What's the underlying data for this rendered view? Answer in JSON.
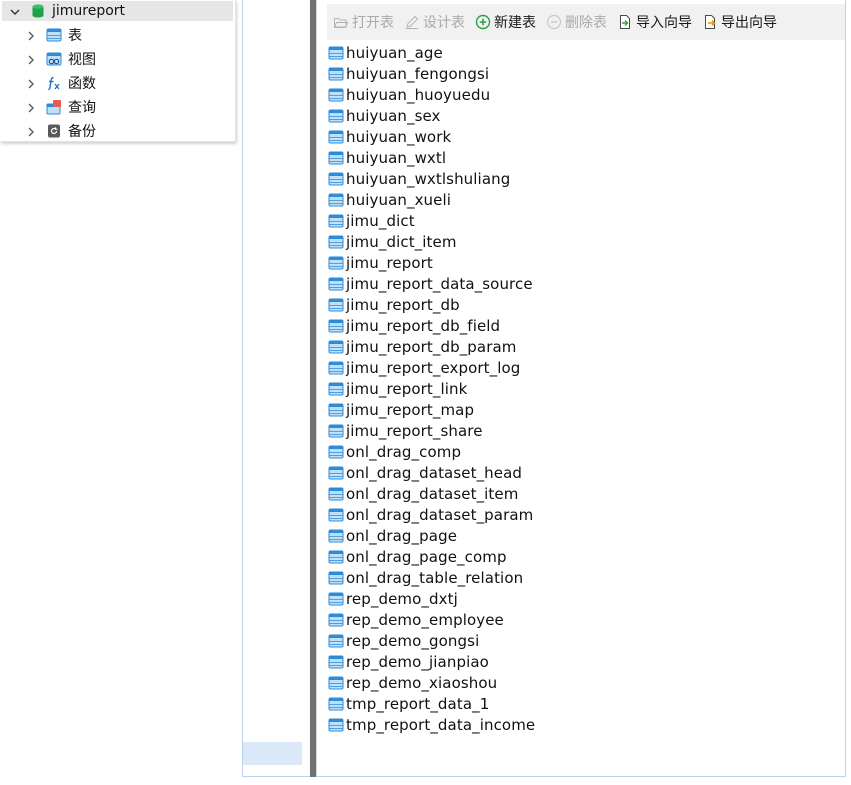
{
  "colors": {
    "accent_blue": "#1a73c6",
    "list_icon_blue": "#2f8ad8",
    "root_db_green": "#1fa34a",
    "new_table_green": "#2ea043",
    "disabled_gray": "#a9a9a9",
    "splitter_gray": "#707070",
    "frame_border": "#bcd3f0"
  },
  "nav_tree": {
    "root": {
      "label": "jimureport",
      "icon": "database-icon",
      "expanded": true
    },
    "children": [
      {
        "label": "表",
        "icon": "table-icon"
      },
      {
        "label": "视图",
        "icon": "view-icon"
      },
      {
        "label": "函数",
        "icon": "function-icon"
      },
      {
        "label": "查询",
        "icon": "query-icon"
      },
      {
        "label": "备份",
        "icon": "backup-icon"
      }
    ]
  },
  "toolbar": {
    "open_table": {
      "label": "打开表",
      "icon": "folder-open-icon",
      "enabled": false
    },
    "design_table": {
      "label": "设计表",
      "icon": "pencil-icon",
      "enabled": false
    },
    "new_table": {
      "label": "新建表",
      "icon": "plus-circle-icon",
      "enabled": true
    },
    "delete_table": {
      "label": "删除表",
      "icon": "minus-circle-icon",
      "enabled": false
    },
    "import_wizard": {
      "label": "导入向导",
      "icon": "import-icon",
      "enabled": true
    },
    "export_wizard": {
      "label": "导出向导",
      "icon": "export-icon",
      "enabled": true
    }
  },
  "tables": [
    "huiyuan_age",
    "huiyuan_fengongsi",
    "huiyuan_huoyuedu",
    "huiyuan_sex",
    "huiyuan_work",
    "huiyuan_wxtl",
    "huiyuan_wxtlshuliang",
    "huiyuan_xueli",
    "jimu_dict",
    "jimu_dict_item",
    "jimu_report",
    "jimu_report_data_source",
    "jimu_report_db",
    "jimu_report_db_field",
    "jimu_report_db_param",
    "jimu_report_export_log",
    "jimu_report_link",
    "jimu_report_map",
    "jimu_report_share",
    "onl_drag_comp",
    "onl_drag_dataset_head",
    "onl_drag_dataset_item",
    "onl_drag_dataset_param",
    "onl_drag_page",
    "onl_drag_page_comp",
    "onl_drag_table_relation",
    "rep_demo_dxtj",
    "rep_demo_employee",
    "rep_demo_gongsi",
    "rep_demo_jianpiao",
    "rep_demo_xiaoshou",
    "tmp_report_data_1",
    "tmp_report_data_income"
  ]
}
